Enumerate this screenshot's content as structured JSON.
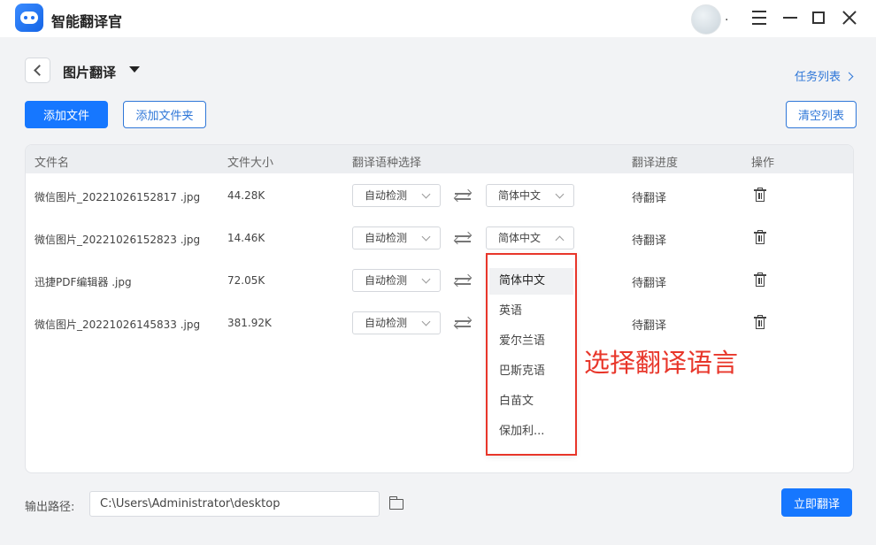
{
  "app": {
    "title": "智能翻译官"
  },
  "titlebar": {
    "avatar_dot": "."
  },
  "header": {
    "title": "图片翻译",
    "task_list": "任务列表"
  },
  "toolbar": {
    "add_file": "添加文件",
    "add_folder": "添加文件夹",
    "clear_list": "清空列表"
  },
  "table": {
    "columns": [
      "文件名",
      "文件大小",
      "翻译语种选择",
      "翻译进度",
      "操作"
    ],
    "rows": [
      {
        "name": "微信图片_20221026152817 .jpg",
        "size": "44.28K",
        "source": "自动检测",
        "target": "简体中文",
        "status": "待翻译"
      },
      {
        "name": "微信图片_20221026152823 .jpg",
        "size": "14.46K",
        "source": "自动检测",
        "target": "简体中文",
        "status": "待翻译"
      },
      {
        "name": "迅捷PDF编辑器 .jpg",
        "size": "72.05K",
        "source": "自动检测",
        "target": "",
        "status": "待翻译"
      },
      {
        "name": "微信图片_20221026145833 .jpg",
        "size": "381.92K",
        "source": "自动检测",
        "target": "",
        "status": "待翻译"
      }
    ]
  },
  "dropdown": {
    "options": [
      "简体中文",
      "英语",
      "爱尔兰语",
      "巴斯克语",
      "白苗文",
      "保加利..."
    ],
    "selected": "简体中文"
  },
  "annotation": {
    "text": "选择翻译语言",
    "color": "#e8362a"
  },
  "footer": {
    "output_label": "输出路径:",
    "output_path": "C:\\Users\\Administrator\\desktop",
    "translate_now": "立即翻译"
  },
  "colors": {
    "primary": "#1677ff",
    "link": "#2f77d8",
    "highlight": "#e8362a"
  }
}
